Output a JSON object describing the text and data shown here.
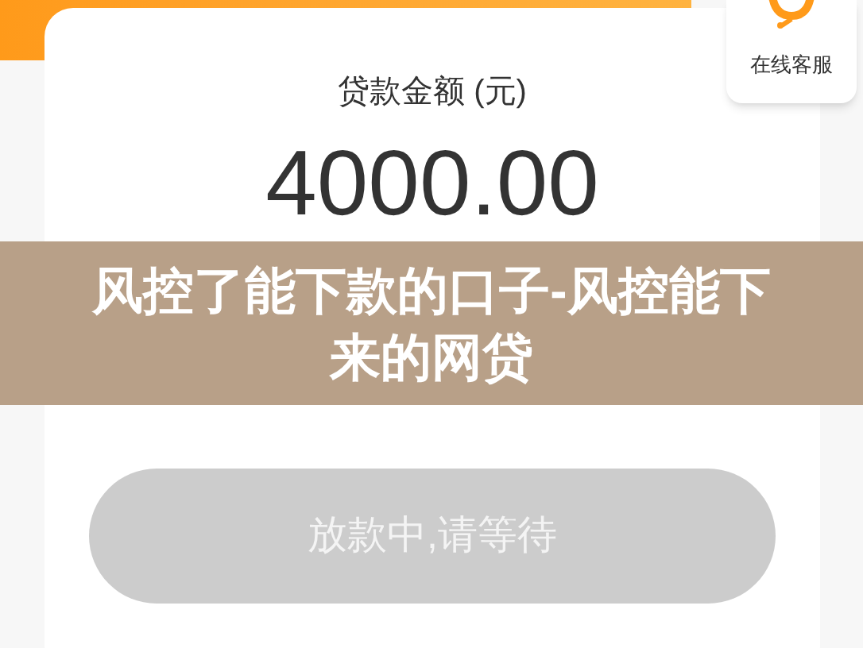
{
  "loan_card": {
    "amount_label": "贷款金额 (元)",
    "amount": "4000.00"
  },
  "service_button": {
    "label": "在线客服"
  },
  "banner": {
    "title": "风控了能下款的口子-风控能下来的网贷"
  },
  "submit_button": {
    "label": "放款中,请等待",
    "disabled": true
  }
}
